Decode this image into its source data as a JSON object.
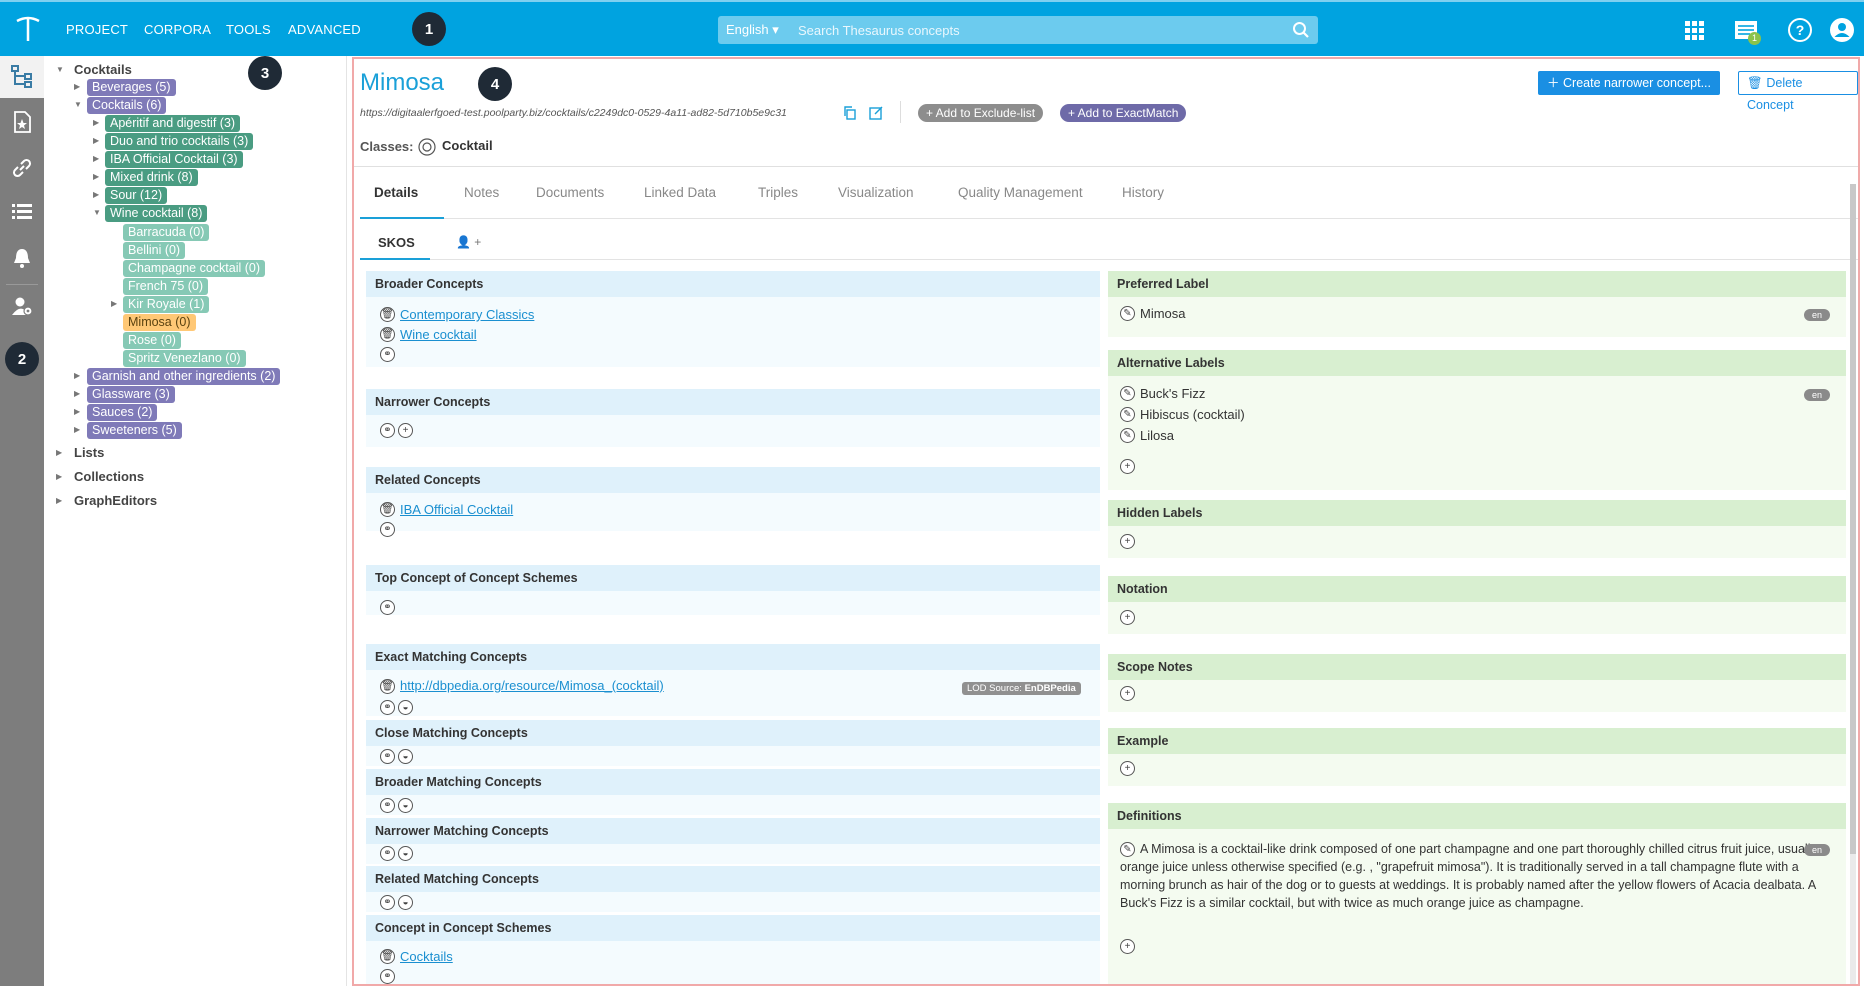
{
  "topbar": {
    "nav": [
      "PROJECT",
      "CORPORA",
      "TOOLS",
      "ADVANCED"
    ],
    "language": "English",
    "search_placeholder": "Search Thesaurus concepts",
    "notification_count": "1",
    "callouts": [
      "1",
      "2",
      "3",
      "4"
    ]
  },
  "tree": {
    "root": "Cocktails",
    "nodes": [
      "Beverages (5)",
      "Cocktails (6)",
      "Apéritif and digestif (3)",
      "Duo and trio cocktails (3)",
      "IBA Official Cocktail (3)",
      "Mixed drink (8)",
      "Sour (12)",
      "Wine cocktail (8)",
      "Barracuda (0)",
      "Bellini (0)",
      "Champagne cocktail (0)",
      "French 75 (0)",
      "Kir Royale (1)",
      "Mimosa (0)",
      "Rose (0)",
      "Spritz Venezlano (0)",
      "Garnish and other ingredients (2)",
      "Glassware (3)",
      "Sauces (2)",
      "Sweeteners (5)"
    ],
    "sections": [
      "Lists",
      "Collections",
      "GraphEditors"
    ]
  },
  "concept": {
    "title": "Mimosa",
    "uri": "https://digitaalerfgoed-test.poolparty.biz/cocktails/c2249dc0-0529-4a11-ad82-5d710b5e9c31",
    "add_exclude": "+ Add to Exclude-list",
    "add_exact": "+ Add to ExactMatch",
    "classes_label": "Classes:",
    "class_value": "Cocktail",
    "create_narrower": "Create narrower concept...",
    "delete": "Delete Concept"
  },
  "tabs": [
    "Details",
    "Notes",
    "Documents",
    "Linked Data",
    "Triples",
    "Visualization",
    "Quality Management",
    "History"
  ],
  "subtabs": {
    "skos": "SKOS",
    "user": "+"
  },
  "left": {
    "broader": {
      "title": "Broader Concepts",
      "items": [
        "Contemporary Classics",
        "Wine cocktail"
      ]
    },
    "narrower": {
      "title": "Narrower Concepts"
    },
    "related": {
      "title": "Related Concepts",
      "items": [
        "IBA Official Cocktail"
      ]
    },
    "topconcept": {
      "title": "Top Concept of Concept Schemes"
    },
    "exact": {
      "title": "Exact Matching Concepts",
      "items": [
        "http://dbpedia.org/resource/Mimosa_(cocktail)"
      ],
      "lod_prefix": "LOD Source:",
      "lod_source": "EnDBPedia"
    },
    "close": {
      "title": "Close Matching Concepts"
    },
    "broadermatch": {
      "title": "Broader Matching Concepts"
    },
    "narrowermatch": {
      "title": "Narrower Matching Concepts"
    },
    "relatedmatch": {
      "title": "Related Matching Concepts"
    },
    "inscheme": {
      "title": "Concept in Concept Schemes",
      "items": [
        "Cocktails"
      ]
    }
  },
  "right": {
    "preferred": {
      "title": "Preferred Label",
      "value": "Mimosa",
      "lang": "en"
    },
    "alternative": {
      "title": "Alternative Labels",
      "items": [
        "Buck's Fizz",
        "Hibiscus (cocktail)",
        "Lilosa"
      ],
      "lang": "en"
    },
    "hidden": {
      "title": "Hidden Labels"
    },
    "notation": {
      "title": "Notation"
    },
    "scope": {
      "title": "Scope Notes"
    },
    "example": {
      "title": "Example"
    },
    "definitions": {
      "title": "Definitions",
      "lang": "en",
      "text": "A Mimosa is a cocktail-like drink composed of one part champagne and one part thoroughly chilled citrus fruit juice, usually orange juice unless otherwise specified (e.g. , \"grapefruit mimosa\"). It is traditionally served in a tall champagne flute with a morning brunch as hair of the dog or to guests at weddings. It is probably named after the yellow flowers of Acacia dealbata. A Buck's Fizz is a similar cocktail, but with twice as much orange juice as champagne."
    }
  },
  "colors": {
    "topbar": "#00a3e0",
    "accent": "#1aa0d8",
    "concept_chip": "#7f7ab8",
    "subconcept_chip": "#4a9c82",
    "leaf_chip": "#86c9b5",
    "selected_chip": "#ffc876"
  }
}
